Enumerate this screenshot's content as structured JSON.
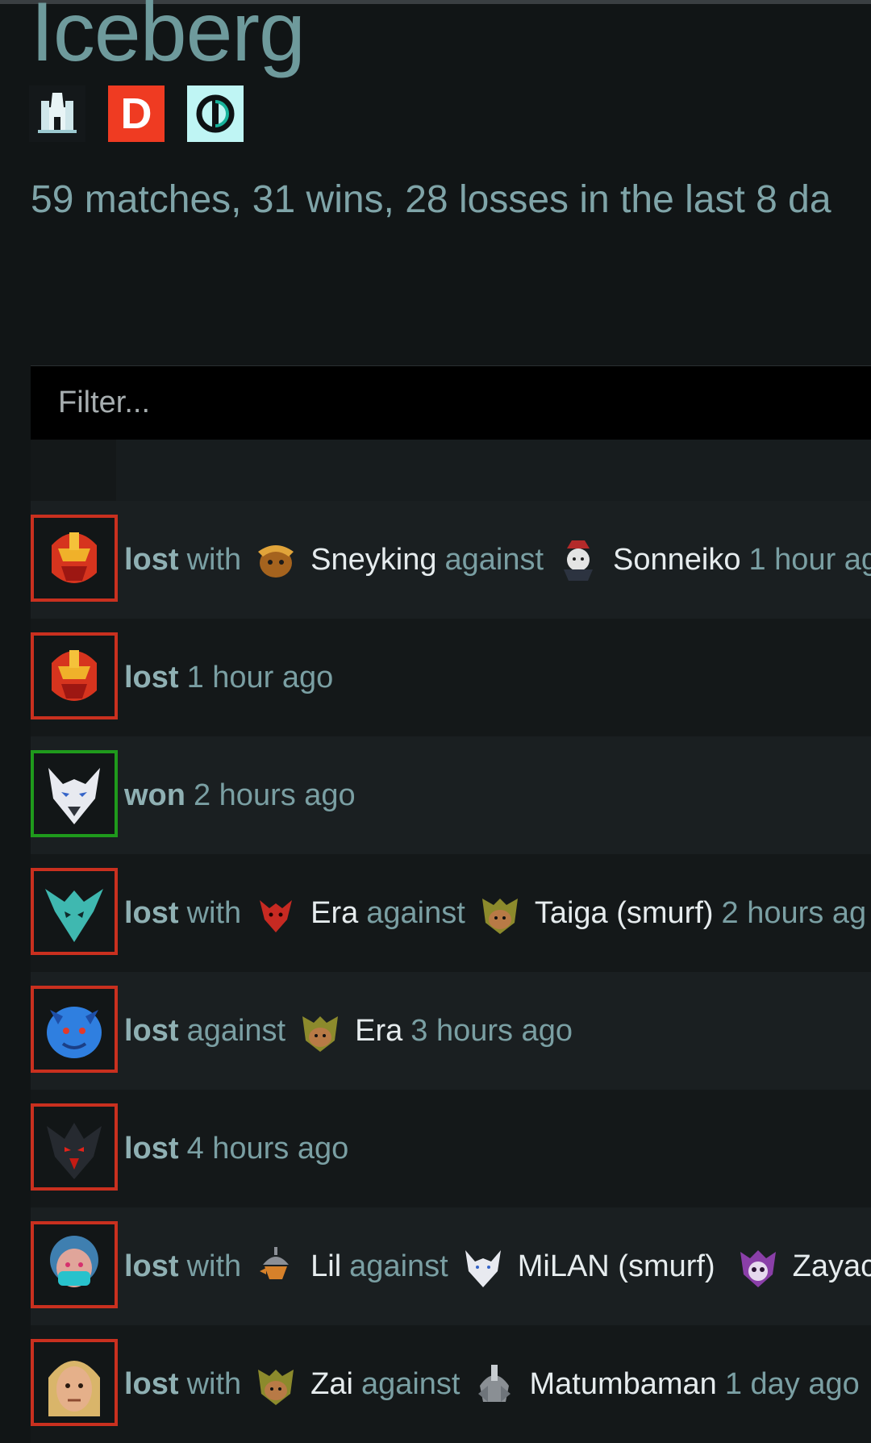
{
  "profile": {
    "name": "Iceberg",
    "summary": "59 matches, 31 wins, 28 losses in the last 8 da"
  },
  "badges": [
    {
      "name": "castle-badge",
      "bg": "#14181a"
    },
    {
      "name": "d-badge",
      "label": "D",
      "bg": "#ef3b22"
    },
    {
      "name": "o-badge",
      "bg": "#bff5f4"
    }
  ],
  "filter": {
    "placeholder": "Filter..."
  },
  "colors": {
    "loss_border": "#c9301f",
    "win_border": "#1f9a1c",
    "text_muted": "#7a9fa3",
    "text_player": "#e6ecee"
  },
  "matches": [
    {
      "result": "lost",
      "with_word": "with",
      "with_player": "Sneyking",
      "against_word": "against",
      "against_player": "Sonneiko",
      "time": "1 hour ag",
      "hero_icon": "red-helmet-hero-icon"
    },
    {
      "result": "lost",
      "time": "1 hour ago",
      "hero_icon": "red-helmet-hero-icon"
    },
    {
      "result": "won",
      "time": "2 hours ago",
      "hero_icon": "white-wolf-hero-icon"
    },
    {
      "result": "lost",
      "with_word": "with",
      "with_player": "Era",
      "against_word": "against",
      "against_player": "Taiga (smurf)",
      "time": "2 hours ag",
      "hero_icon": "teal-dragon-hero-icon"
    },
    {
      "result": "lost",
      "against_word": "against",
      "against_player": "Era",
      "time": "3 hours ago",
      "hero_icon": "blue-creature-hero-icon"
    },
    {
      "result": "lost",
      "time": "4 hours ago",
      "hero_icon": "dark-demon-hero-icon"
    },
    {
      "result": "lost",
      "with_word": "with",
      "with_player": "Lil",
      "against_word": "against",
      "against_player": "MiLAN (smurf)",
      "third_player": "Zayac",
      "hero_icon": "masked-hero-icon"
    },
    {
      "result": "lost",
      "with_word": "with",
      "with_player": "Zai",
      "against_word": "against",
      "against_player": "Matumbaman",
      "time": "1 day ago",
      "hero_icon": "blond-warrior-hero-icon"
    }
  ]
}
